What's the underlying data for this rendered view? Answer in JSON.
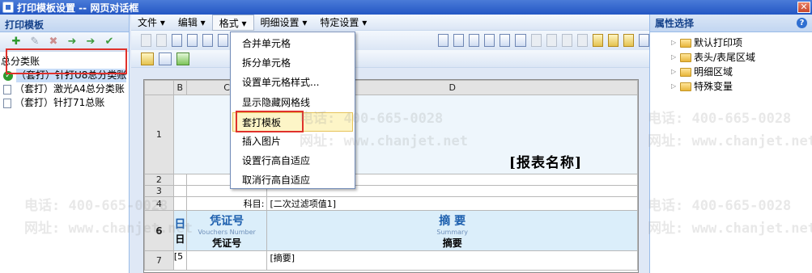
{
  "window": {
    "title": "打印模板设置 -- 网页对话框",
    "close_glyph": "✕"
  },
  "left_panel": {
    "header": "打印模板",
    "tree_root": "总分类账",
    "templates": [
      "（套打）针打U8总分类账",
      "（套打）激光A4总分类账",
      "（套打）针打71总账"
    ]
  },
  "menu": {
    "items": [
      "文件 ▾",
      "编辑 ▾",
      "格式 ▾",
      "明细设置 ▾",
      "特定设置 ▾"
    ]
  },
  "format_menu": {
    "items": [
      "合并单元格",
      "拆分单元格",
      "设置单元格样式...",
      "显示隐藏网格线",
      "套打模板",
      "插入图片",
      "设置行高自适应",
      "取消行高自适应"
    ]
  },
  "sheet": {
    "col_headers": [
      "B",
      "C",
      "D"
    ],
    "row_headers": [
      "1",
      "2",
      "3",
      "4",
      "6",
      "7"
    ],
    "report_title": "[报表名称]",
    "subject_label": "科目:",
    "subject_value": "[二次过滤项值1]",
    "row6": {
      "day_top": "日",
      "day_bottom": "日",
      "voucher_big": "凭证号",
      "voucher_sub": "Vouchers Number",
      "voucher_cn": "凭证号",
      "summary_big": "摘 要",
      "summary_sub": "Summary",
      "summary_cn": "摘要"
    },
    "row7_b": "[5",
    "row7_d": "[摘要]"
  },
  "right_panel": {
    "header": "属性选择",
    "help_glyph": "?",
    "nodes": [
      "默认打印项",
      "表头/表尾区域",
      "明细区域",
      "特殊变量"
    ]
  },
  "watermark": {
    "phone": "电话: 400-665-0028",
    "site": "网址: www.chanjet.net"
  }
}
